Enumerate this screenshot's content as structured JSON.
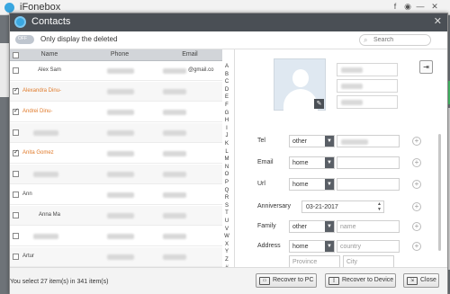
{
  "app": {
    "title": "iFonebox",
    "controls": [
      "f",
      "◉",
      "—",
      "✕"
    ]
  },
  "dialog": {
    "title": "Contacts",
    "close": "✕",
    "toggle_label": "OFF",
    "only_deleted_label": "Only display the deleted",
    "search_placeholder": "Search"
  },
  "table": {
    "headers": {
      "name": "Name",
      "phone": "Phone",
      "email": "Email"
    },
    "rows": [
      {
        "name": "Alex Sam",
        "checked": false,
        "email_suffix": "@gmail.co",
        "name_style": "center"
      },
      {
        "name": "Alexandra Dinu-",
        "checked": true,
        "email_suffix": "",
        "name_style": "orange"
      },
      {
        "name": "Andrei Dinu-",
        "checked": true,
        "email_suffix": "",
        "name_style": "orange"
      },
      {
        "name": "",
        "checked": false,
        "email_suffix": "",
        "name_style": "blur"
      },
      {
        "name": "Anita Gomez",
        "checked": true,
        "email_suffix": "",
        "name_style": "orange"
      },
      {
        "name": "",
        "checked": false,
        "email_suffix": "",
        "name_style": "blur"
      },
      {
        "name": "Ann",
        "checked": false,
        "email_suffix": "",
        "name_style": "left"
      },
      {
        "name": "Anna Ma",
        "checked": false,
        "email_suffix": "",
        "name_style": "center"
      },
      {
        "name": "",
        "checked": false,
        "email_suffix": "",
        "name_style": "blur"
      },
      {
        "name": "Artur",
        "checked": false,
        "email_suffix": "",
        "name_style": "left"
      }
    ],
    "alphabet": [
      "A",
      "B",
      "C",
      "D",
      "E",
      "F",
      "G",
      "H",
      "I",
      "J",
      "K",
      "L",
      "M",
      "N",
      "O",
      "P",
      "Q",
      "R",
      "S",
      "T",
      "U",
      "V",
      "W",
      "X",
      "Y",
      "Z",
      "#"
    ]
  },
  "detail": {
    "tel": {
      "label": "Tel",
      "type": "other"
    },
    "email": {
      "label": "Email",
      "type": "home"
    },
    "url": {
      "label": "Url",
      "type": "home"
    },
    "anniversary": {
      "label": "Anniversary",
      "date": "03-21-2017"
    },
    "family": {
      "label": "Family",
      "type": "other",
      "placeholder": "name"
    },
    "address": {
      "label": "Address",
      "type": "home",
      "country_placeholder": "country",
      "province_placeholder": "Province",
      "city_placeholder": "City"
    }
  },
  "footer": {
    "status": "You select 27 item(s) in 341 item(s)",
    "recover_pc": "Recover to PC",
    "recover_device": "Recover to Device",
    "close": "Close"
  }
}
